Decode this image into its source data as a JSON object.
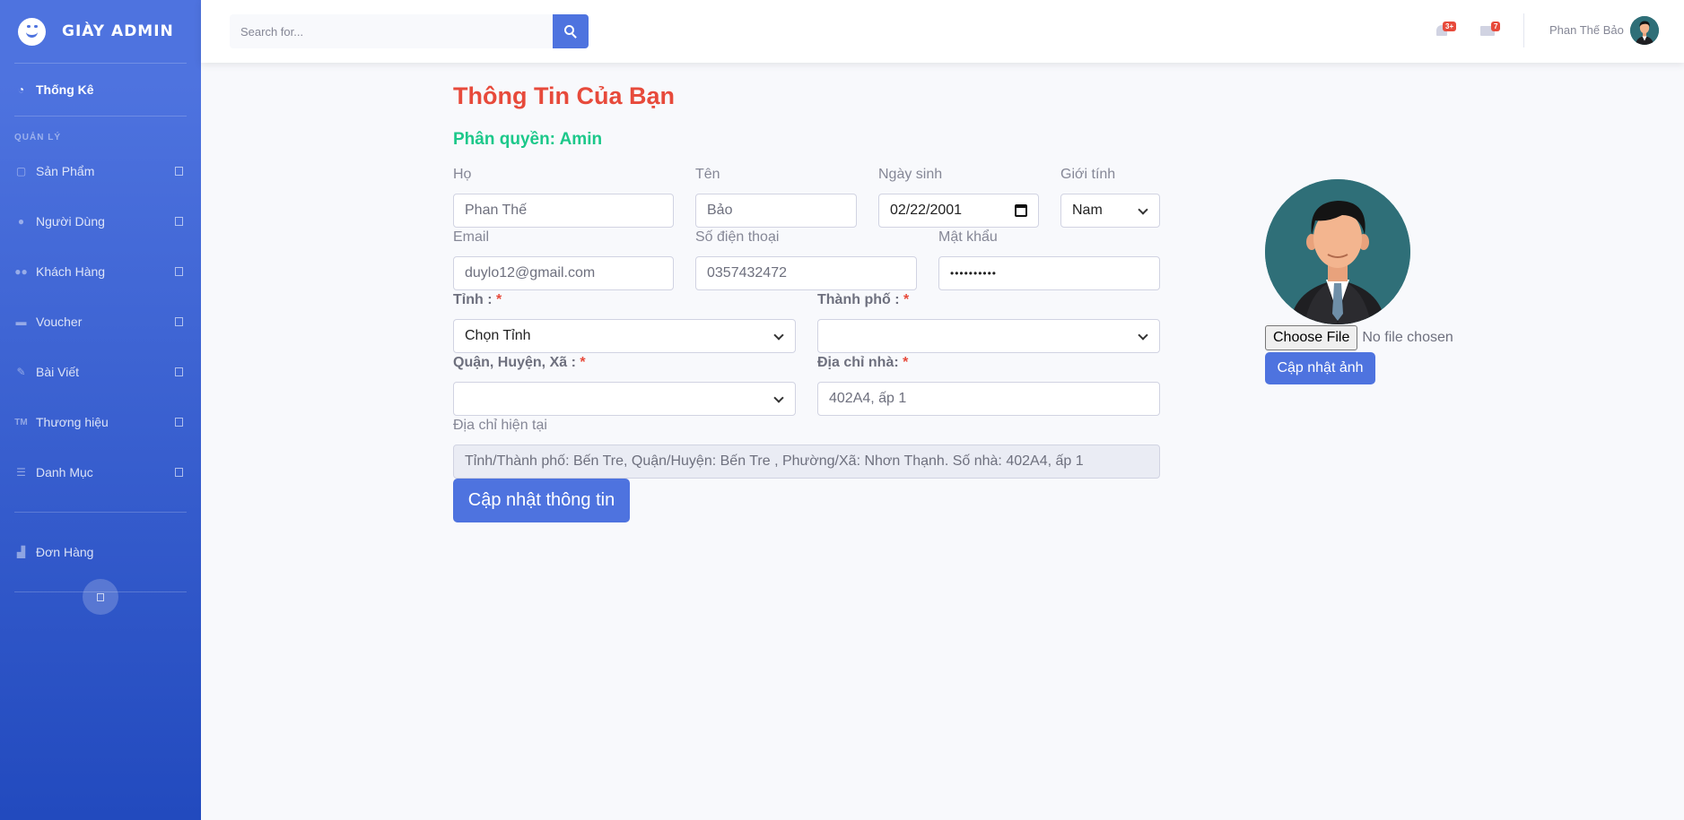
{
  "brand": {
    "title": "GIÀY ADMIN"
  },
  "sidebar": {
    "dashboard": "Thống Kê",
    "heading": "QUẢN LÝ",
    "items": [
      {
        "label": "Sản Phẩm",
        "icon": "box-icon"
      },
      {
        "label": "Người Dùng",
        "icon": "user-icon"
      },
      {
        "label": "Khách Hàng",
        "icon": "users-icon"
      },
      {
        "label": "Voucher",
        "icon": "ticket-icon"
      },
      {
        "label": "Bài Viết",
        "icon": "blog-icon"
      },
      {
        "label": "Thương hiệu",
        "icon": "trademark-icon"
      },
      {
        "label": "Danh Mục",
        "icon": "list-icon"
      }
    ],
    "orders": "Đơn Hàng"
  },
  "topbar": {
    "search_placeholder": "Search for...",
    "alerts_badge": "3+",
    "messages_badge": "7",
    "user_name": "Phan Thế Bảo"
  },
  "profile": {
    "title": "Thông Tin Của Bạn",
    "role": "Phân quyền: Amin",
    "labels": {
      "last_name": "Họ",
      "first_name": "Tên",
      "birthday": "Ngày sinh",
      "gender": "Giới tính",
      "email": "Email",
      "phone": "Số điện thoại",
      "password": "Mật khẩu",
      "province": "Tỉnh :",
      "city": "Thành phố :",
      "district": "Quận, Huyện, Xã :",
      "address": "Địa chỉ nhà:",
      "current_address": "Địa chỉ hiện tại",
      "required": "*"
    },
    "values": {
      "last_name": "Phan Thế",
      "first_name": "Bảo",
      "birthday": "02/22/2001",
      "gender": "Nam",
      "email": "duylo12@gmail.com",
      "phone": "0357432472",
      "password": "••••••••••",
      "province": "Chọn Tỉnh",
      "city": "",
      "district": "",
      "address": "402A4, ấp 1",
      "current_address": "Tỉnh/Thành phố: Bến Tre, Quận/Huyện: Bến Tre , Phường/Xã: Nhơn Thạnh. Số nhà: 402A4, ấp 1"
    },
    "update_button": "Cập nhật thông tin",
    "choose_file": "Choose File",
    "no_file": "No file chosen",
    "update_photo": "Cập nhật ảnh"
  },
  "colors": {
    "primary": "#4e73df",
    "danger": "#e74a3b",
    "success": "#1cc88a"
  }
}
